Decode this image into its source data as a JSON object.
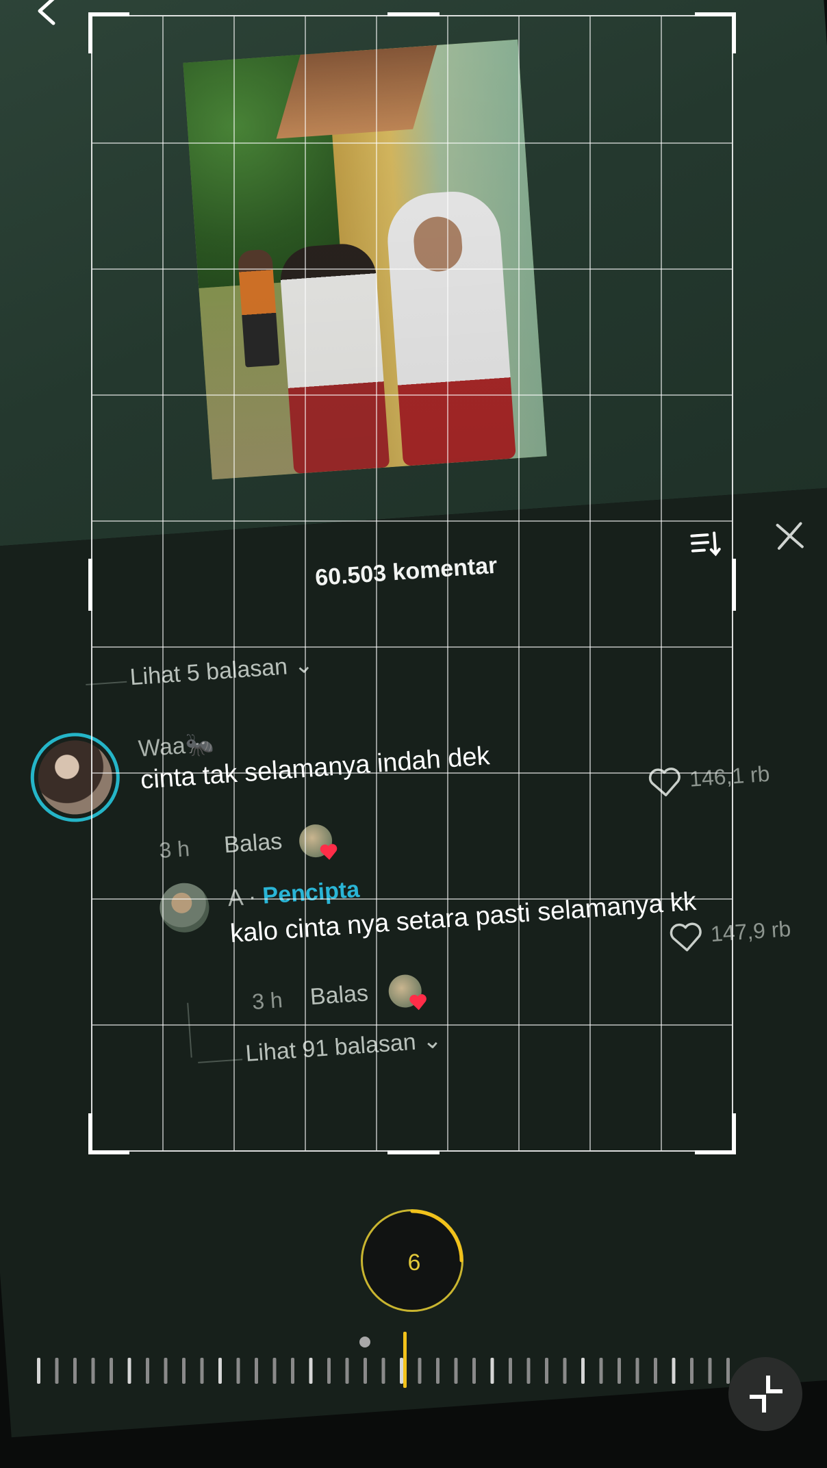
{
  "comments_sheet": {
    "count_label": "60.503 komentar",
    "sort_icon": "sort-icon",
    "close_icon": "close-icon",
    "view_replies_top": "Lihat 5 balasan",
    "comment": {
      "username": "Waa🐜",
      "text": "cinta tak selamanya indah dek",
      "time": "3 h",
      "reply_label": "Balas",
      "like_count": "146,1 rb"
    },
    "reply": {
      "username": "A · ",
      "creator_badge": "Pencipta",
      "text": "kalo cinta nya setara pasti selamanya kk",
      "time": "3 h",
      "reply_label": "Balas",
      "like_count": "147,9 rb"
    },
    "view_replies_bottom": "Lihat 91 balasan"
  },
  "editor": {
    "rotation_angle": "6",
    "back_icon": "back-icon",
    "compress_icon": "compress-icon"
  },
  "colors": {
    "accent_yellow": "#f2c21b",
    "creator_blue": "#2ab5d6",
    "avatar_ring": "#25b5c8",
    "like_red": "#ff2d48"
  }
}
